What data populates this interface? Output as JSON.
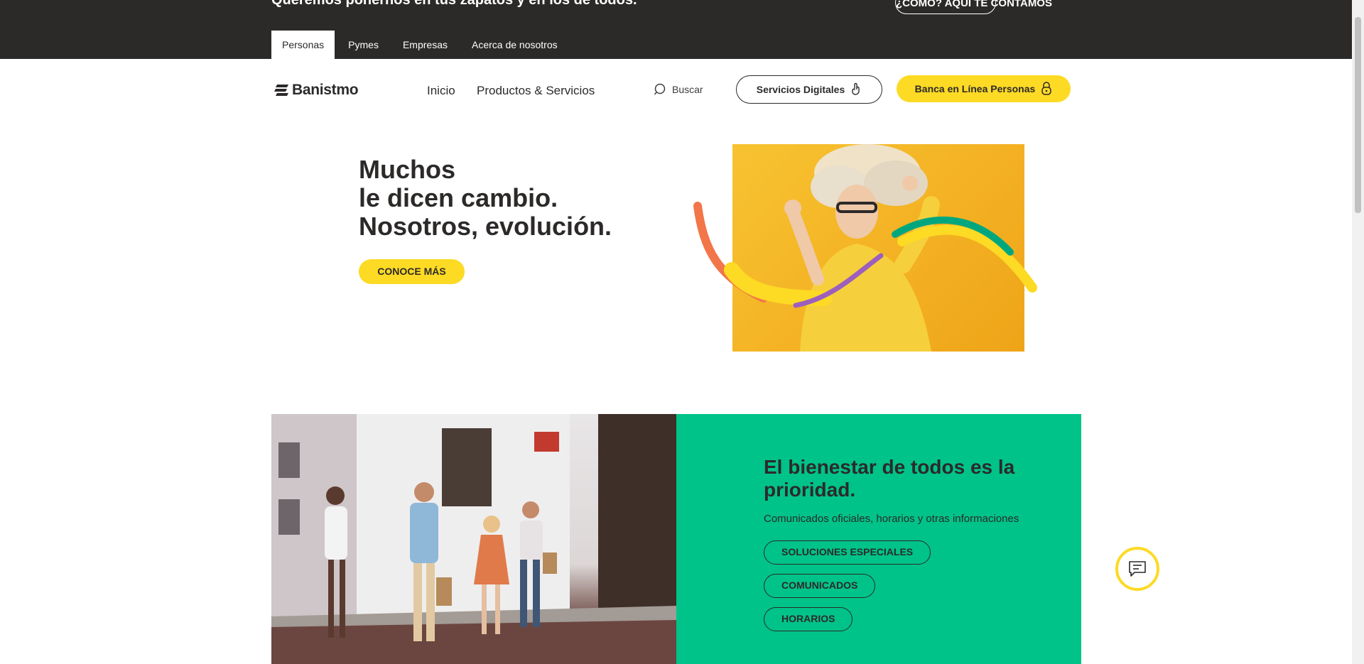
{
  "promo": {
    "text": "Queremos ponernos en tus zapatos y en los de todos.",
    "button": "¿CÓMO? AQUÍ TE CONTAMOS"
  },
  "top_tabs": [
    "Personas",
    "Pymes",
    "Empresas",
    "Acerca de nosotros"
  ],
  "header": {
    "logo": "Banistmo",
    "nav": [
      "Inicio",
      "Productos & Servicios"
    ],
    "search": "Buscar",
    "digital_services": "Servicios Digitales",
    "online_banking": "Banca en Línea Personas"
  },
  "hero": {
    "lines": [
      "Muchos",
      "le dicen cambio.",
      "Nosotros, evolución."
    ],
    "cta": "CONOCE MÁS"
  },
  "wellbeing": {
    "title": "El bienestar de todos es la prioridad.",
    "subtitle": "Comunicados oficiales, horarios y otras informaciones",
    "buttons": [
      "SOLUCIONES ESPECIALES",
      "COMUNICADOS",
      "HORARIOS"
    ]
  },
  "colors": {
    "brand_yellow": "#fdda24",
    "brand_green": "#00c389",
    "dark": "#2c2a29"
  },
  "icons": {
    "search": "search-icon",
    "digital": "hand-touch-icon",
    "banking": "lock-icon",
    "chat": "chat-icon"
  }
}
